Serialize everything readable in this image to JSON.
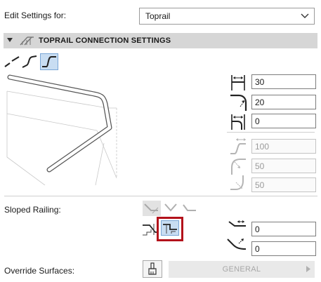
{
  "edit_settings": {
    "label": "Edit Settings for:",
    "selected": "Toprail"
  },
  "section": {
    "title": "TOPRAIL CONNECTION SETTINGS"
  },
  "connection_types": [
    {
      "name": "straight-connection",
      "selected": false
    },
    {
      "name": "curved-connection",
      "selected": false
    },
    {
      "name": "s-connection",
      "selected": true
    }
  ],
  "fields": {
    "horizontal_offset": "30",
    "radius": "20",
    "end_offset": "0",
    "s_length": "100",
    "s_radius_1": "50",
    "s_radius_2": "50"
  },
  "sloped_railing": {
    "label": "Sloped Railing:",
    "angle_value": "0",
    "radius_value": "0"
  },
  "override_surfaces": {
    "label": "Override Surfaces:",
    "dropdown": "GENERAL"
  },
  "colors": {
    "accent_selected_bg": "#c8ddf2",
    "highlight_box": "#b3121b",
    "section_bg": "#d6d6d6"
  }
}
